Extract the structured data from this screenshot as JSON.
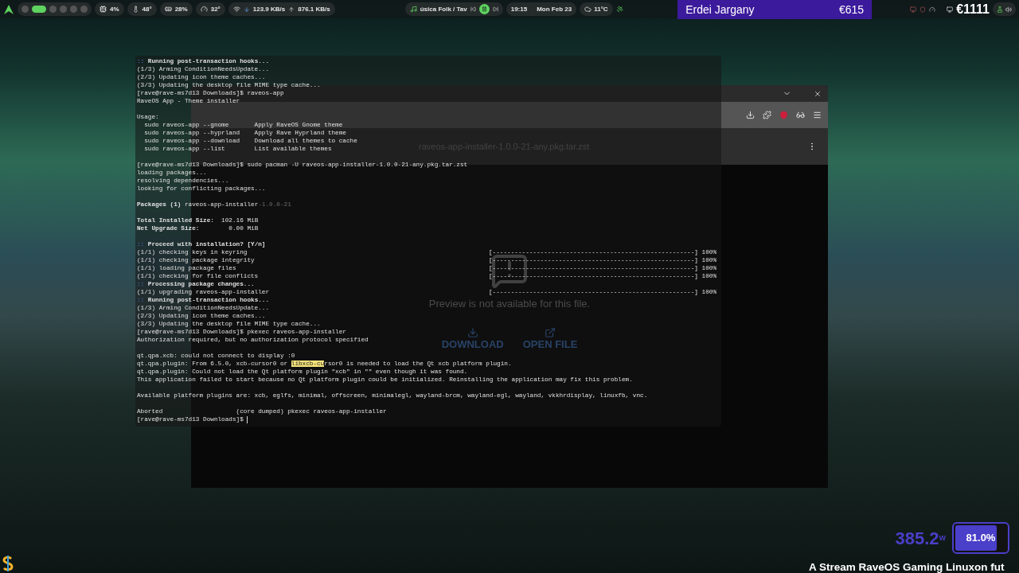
{
  "top_bar": {
    "workspaces": [
      {
        "selected": false
      },
      {
        "selected": true
      },
      {
        "selected": false
      },
      {
        "selected": false
      },
      {
        "selected": false
      },
      {
        "selected": false
      }
    ],
    "stats": [
      {
        "kind": "cpu",
        "value": "4%"
      },
      {
        "kind": "temperature",
        "value": "48°"
      },
      {
        "kind": "memory",
        "value": "28%"
      },
      {
        "kind": "gpu",
        "value": "32°"
      }
    ],
    "network": {
      "down": "123.9 KB/s",
      "up": "876.1 KB/s"
    },
    "media": {
      "title": "úsica Folk / Tav",
      "playing": true
    },
    "clock": {
      "time": "19:15",
      "date": "Mon Feb 23"
    },
    "weather": "11°C",
    "banner": {
      "name": "Erdei Jargany",
      "amount": "€615"
    },
    "total": "€1111"
  },
  "browser": {
    "file_title": "raveos-app-installer-1.0.0-21-any.pkg.tar.zst",
    "preview_message": "Preview is not available for this file.",
    "actions": [
      {
        "kind": "download",
        "label": "DOWNLOAD"
      },
      {
        "kind": "open",
        "label": "OPEN FILE"
      }
    ]
  },
  "terminal": {
    "lines": [
      {
        "kind": "text",
        "parts": [
          {
            "kind": "marker",
            "text": ":: "
          },
          {
            "kind": "bold",
            "text": "Running post-transaction hooks..."
          }
        ]
      },
      {
        "kind": "text",
        "parts": [
          {
            "kind": "plain",
            "text": "(1/3) Arming ConditionNeedsUpdate..."
          }
        ]
      },
      {
        "kind": "text",
        "parts": [
          {
            "kind": "plain",
            "text": "(2/3) Updating icon theme caches..."
          }
        ]
      },
      {
        "kind": "text",
        "parts": [
          {
            "kind": "plain",
            "text": "(3/3) Updating the desktop file MIME type cache..."
          }
        ]
      },
      {
        "kind": "text",
        "parts": [
          {
            "kind": "plain",
            "text": "[rave@rave-ms7d13 Downloads]$ raveos-app"
          }
        ]
      },
      {
        "kind": "text",
        "parts": [
          {
            "kind": "plain",
            "text": "RaveOS App - Theme installer"
          }
        ]
      },
      {
        "kind": "blank"
      },
      {
        "kind": "text",
        "parts": [
          {
            "kind": "plain",
            "text": "Usage:"
          }
        ]
      },
      {
        "kind": "text",
        "parts": [
          {
            "kind": "plain",
            "text": "  sudo raveos-app --gnome       Apply RaveOS Gnome theme"
          }
        ]
      },
      {
        "kind": "text",
        "parts": [
          {
            "kind": "plain",
            "text": "  sudo raveos-app --hyprland    Apply Rave Hyprland theme"
          }
        ]
      },
      {
        "kind": "text",
        "parts": [
          {
            "kind": "plain",
            "text": "  sudo raveos-app --download    Download all themes to cache"
          }
        ]
      },
      {
        "kind": "text",
        "parts": [
          {
            "kind": "plain",
            "text": "  sudo raveos-app --list        List available themes"
          }
        ]
      },
      {
        "kind": "blank"
      },
      {
        "kind": "text",
        "parts": [
          {
            "kind": "plain",
            "text": "[rave@rave-ms7d13 Downloads]$ sudo pacman -U raveos-app-installer-1.0.0-21-any.pkg.tar.zst"
          }
        ]
      },
      {
        "kind": "text",
        "parts": [
          {
            "kind": "plain",
            "text": "loading packages..."
          }
        ]
      },
      {
        "kind": "text",
        "parts": [
          {
            "kind": "plain",
            "text": "resolving dependencies..."
          }
        ]
      },
      {
        "kind": "text",
        "parts": [
          {
            "kind": "plain",
            "text": "looking for conflicting packages..."
          }
        ]
      },
      {
        "kind": "blank"
      },
      {
        "kind": "text",
        "parts": [
          {
            "kind": "bold",
            "text": "Packages (1) "
          },
          {
            "kind": "plain",
            "text": "raveos-app-installer"
          },
          {
            "kind": "dim",
            "text": "-1.0.0-21"
          }
        ]
      },
      {
        "kind": "blank"
      },
      {
        "kind": "text",
        "parts": [
          {
            "kind": "bold",
            "text": "Total Installed Size:"
          },
          {
            "kind": "plain",
            "text": "  102.16 MiB"
          }
        ]
      },
      {
        "kind": "text",
        "parts": [
          {
            "kind": "bold",
            "text": "Net Upgrade Size:"
          },
          {
            "kind": "plain",
            "text": "        0.00 MiB"
          }
        ]
      },
      {
        "kind": "blank"
      },
      {
        "kind": "text",
        "parts": [
          {
            "kind": "marker",
            "text": ":: "
          },
          {
            "kind": "bold",
            "text": "Proceed with installation? [Y/n]"
          }
        ]
      },
      {
        "kind": "text",
        "parts": [
          {
            "kind": "plain",
            "text": "(1/1) checking keys in keyring"
          }
        ],
        "progress": "[-------------------------------------------------------] 100%"
      },
      {
        "kind": "text",
        "parts": [
          {
            "kind": "plain",
            "text": "(1/1) checking package integrity"
          }
        ],
        "progress": "[-------------------------------------------------------] 100%"
      },
      {
        "kind": "text",
        "parts": [
          {
            "kind": "plain",
            "text": "(1/1) loading package files"
          }
        ],
        "progress": "[-------------------------------------------------------] 100%"
      },
      {
        "kind": "text",
        "parts": [
          {
            "kind": "plain",
            "text": "(1/1) checking for file conflicts"
          }
        ],
        "progress": "[-------------------------------------------------------] 100%"
      },
      {
        "kind": "text",
        "parts": [
          {
            "kind": "marker",
            "text": ":: "
          },
          {
            "kind": "bold",
            "text": "Processing package changes..."
          }
        ]
      },
      {
        "kind": "text",
        "parts": [
          {
            "kind": "plain",
            "text": "(1/1) upgrading raveos-app-installer"
          }
        ],
        "progress": "[-------------------------------------------------------] 100%"
      },
      {
        "kind": "text",
        "parts": [
          {
            "kind": "marker",
            "text": ":: "
          },
          {
            "kind": "bold",
            "text": "Running post-transaction hooks..."
          }
        ]
      },
      {
        "kind": "text",
        "parts": [
          {
            "kind": "plain",
            "text": "(1/3) Arming ConditionNeedsUpdate..."
          }
        ]
      },
      {
        "kind": "text",
        "parts": [
          {
            "kind": "plain",
            "text": "(2/3) Updating icon theme caches..."
          }
        ]
      },
      {
        "kind": "text",
        "parts": [
          {
            "kind": "plain",
            "text": "(3/3) Updating the desktop file MIME type cache..."
          }
        ]
      },
      {
        "kind": "text",
        "parts": [
          {
            "kind": "plain",
            "text": "[rave@rave-ms7d13 Downloads]$ pkexec raveos-app-installer"
          }
        ]
      },
      {
        "kind": "text",
        "parts": [
          {
            "kind": "plain",
            "text": "Authorization required, but no authorization protocol specified"
          }
        ]
      },
      {
        "kind": "blank"
      },
      {
        "kind": "text",
        "parts": [
          {
            "kind": "plain",
            "text": "qt.qpa.xcb: could not connect to display :0"
          }
        ]
      },
      {
        "kind": "text",
        "parts": [
          {
            "kind": "plain",
            "text": "qt.qpa.plugin: From 6.5.0, xcb-cursor0 or "
          },
          {
            "kind": "selected",
            "text": "libxcb-cu"
          },
          {
            "kind": "plain",
            "text": "rsor0 is needed to load the Qt xcb platform plugin."
          }
        ]
      },
      {
        "kind": "text",
        "parts": [
          {
            "kind": "plain",
            "text": "qt.qpa.plugin: Could not load the Qt platform plugin \"xcb\" in \"\" even though it was found."
          }
        ]
      },
      {
        "kind": "text",
        "parts": [
          {
            "kind": "plain",
            "text": "This application failed to start because no Qt platform plugin could be initialized. Reinstalling the application may fix this problem."
          }
        ]
      },
      {
        "kind": "blank"
      },
      {
        "kind": "text",
        "parts": [
          {
            "kind": "plain",
            "text": "Available platform plugins are: xcb, eglfs, minimal, offscreen, minimalegl, wayland-brcm, wayland-egl, wayland, vkkhrdisplay, linuxfb, vnc."
          }
        ]
      },
      {
        "kind": "blank"
      },
      {
        "kind": "text",
        "parts": [
          {
            "kind": "plain",
            "text": "Aborted                    (core dumped) pkexec raveos-app-installer"
          }
        ]
      },
      {
        "kind": "text",
        "parts": [
          {
            "kind": "plain",
            "text": "[rave@rave-ms7d13 Downloads]$"
          }
        ],
        "cursor": true
      }
    ]
  },
  "overlay": {
    "power": "385.2",
    "power_unit": "W",
    "battery": {
      "label": "81.0%",
      "level": 0.81
    },
    "caption": "A Stream RaveOS Gaming Linuxon fut"
  }
}
